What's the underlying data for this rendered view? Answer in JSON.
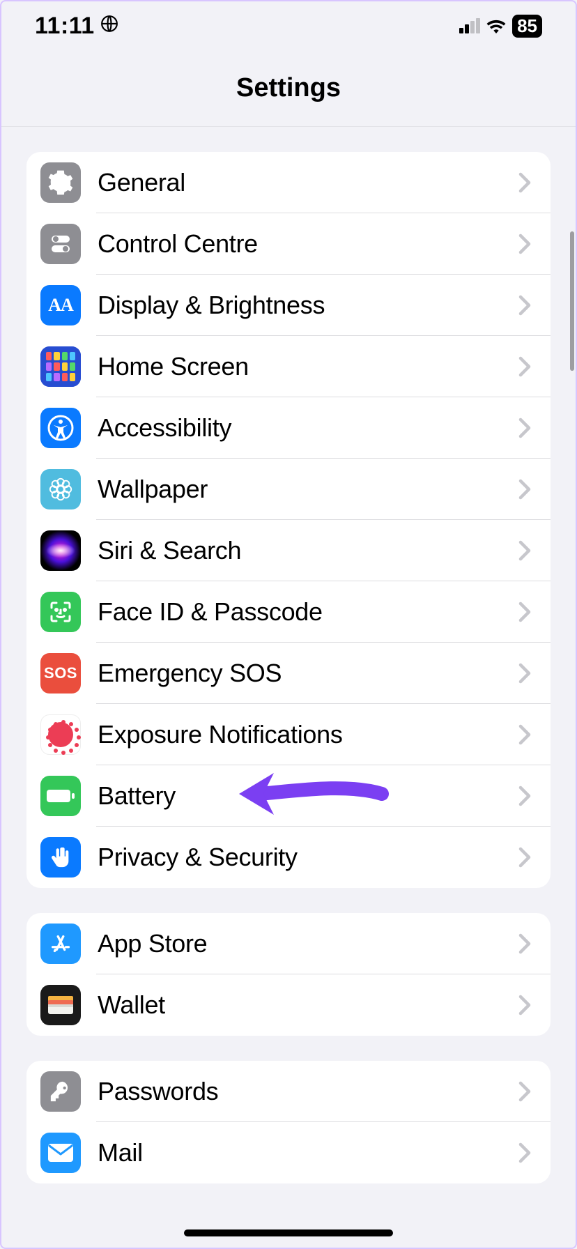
{
  "status": {
    "time": "11:11",
    "battery_percent": "85"
  },
  "header": {
    "title": "Settings"
  },
  "groups": [
    {
      "rows": [
        {
          "id": "general",
          "label": "General",
          "icon": "gear",
          "bg": "#8e8e93"
        },
        {
          "id": "control-centre",
          "label": "Control Centre",
          "icon": "toggles",
          "bg": "#8e8e93"
        },
        {
          "id": "display-brightness",
          "label": "Display & Brightness",
          "icon": "aa",
          "bg": "#0a7aff"
        },
        {
          "id": "home-screen",
          "label": "Home Screen",
          "icon": "home-grid",
          "bg": "#274dd1"
        },
        {
          "id": "accessibility",
          "label": "Accessibility",
          "icon": "accessibility",
          "bg": "#0a7aff"
        },
        {
          "id": "wallpaper",
          "label": "Wallpaper",
          "icon": "flower",
          "bg": "#50bcdf"
        },
        {
          "id": "siri-search",
          "label": "Siri & Search",
          "icon": "siri",
          "bg": "#000"
        },
        {
          "id": "faceid-passcode",
          "label": "Face ID & Passcode",
          "icon": "faceid",
          "bg": "#34c759"
        },
        {
          "id": "emergency-sos",
          "label": "Emergency SOS",
          "icon": "sos",
          "bg": "#ea4e3d"
        },
        {
          "id": "exposure-notifications",
          "label": "Exposure Notifications",
          "icon": "exposure",
          "bg": "#fff"
        },
        {
          "id": "battery",
          "label": "Battery",
          "icon": "battery-full",
          "bg": "#34c759",
          "annotated": true
        },
        {
          "id": "privacy-security",
          "label": "Privacy & Security",
          "icon": "hand",
          "bg": "#0a7aff"
        }
      ]
    },
    {
      "rows": [
        {
          "id": "app-store",
          "label": "App Store",
          "icon": "appstore",
          "bg": "#1f99ff"
        },
        {
          "id": "wallet",
          "label": "Wallet",
          "icon": "wallet",
          "bg": "#000"
        }
      ]
    },
    {
      "rows": [
        {
          "id": "passwords",
          "label": "Passwords",
          "icon": "key",
          "bg": "#8e8e93"
        },
        {
          "id": "mail",
          "label": "Mail",
          "icon": "mail",
          "bg": "#1f99ff"
        }
      ]
    }
  ],
  "home_grid_colors": [
    "#ff5b5b",
    "#ffd23a",
    "#54d86a",
    "#4ec6ff",
    "#b96bff",
    "#ff5b5b",
    "#ffd23a",
    "#54d86a",
    "#4ec6ff",
    "#b96bff",
    "#ff5b5b",
    "#ffd23a"
  ],
  "icons": {
    "aa_text": "AA",
    "sos_text": "SOS"
  }
}
